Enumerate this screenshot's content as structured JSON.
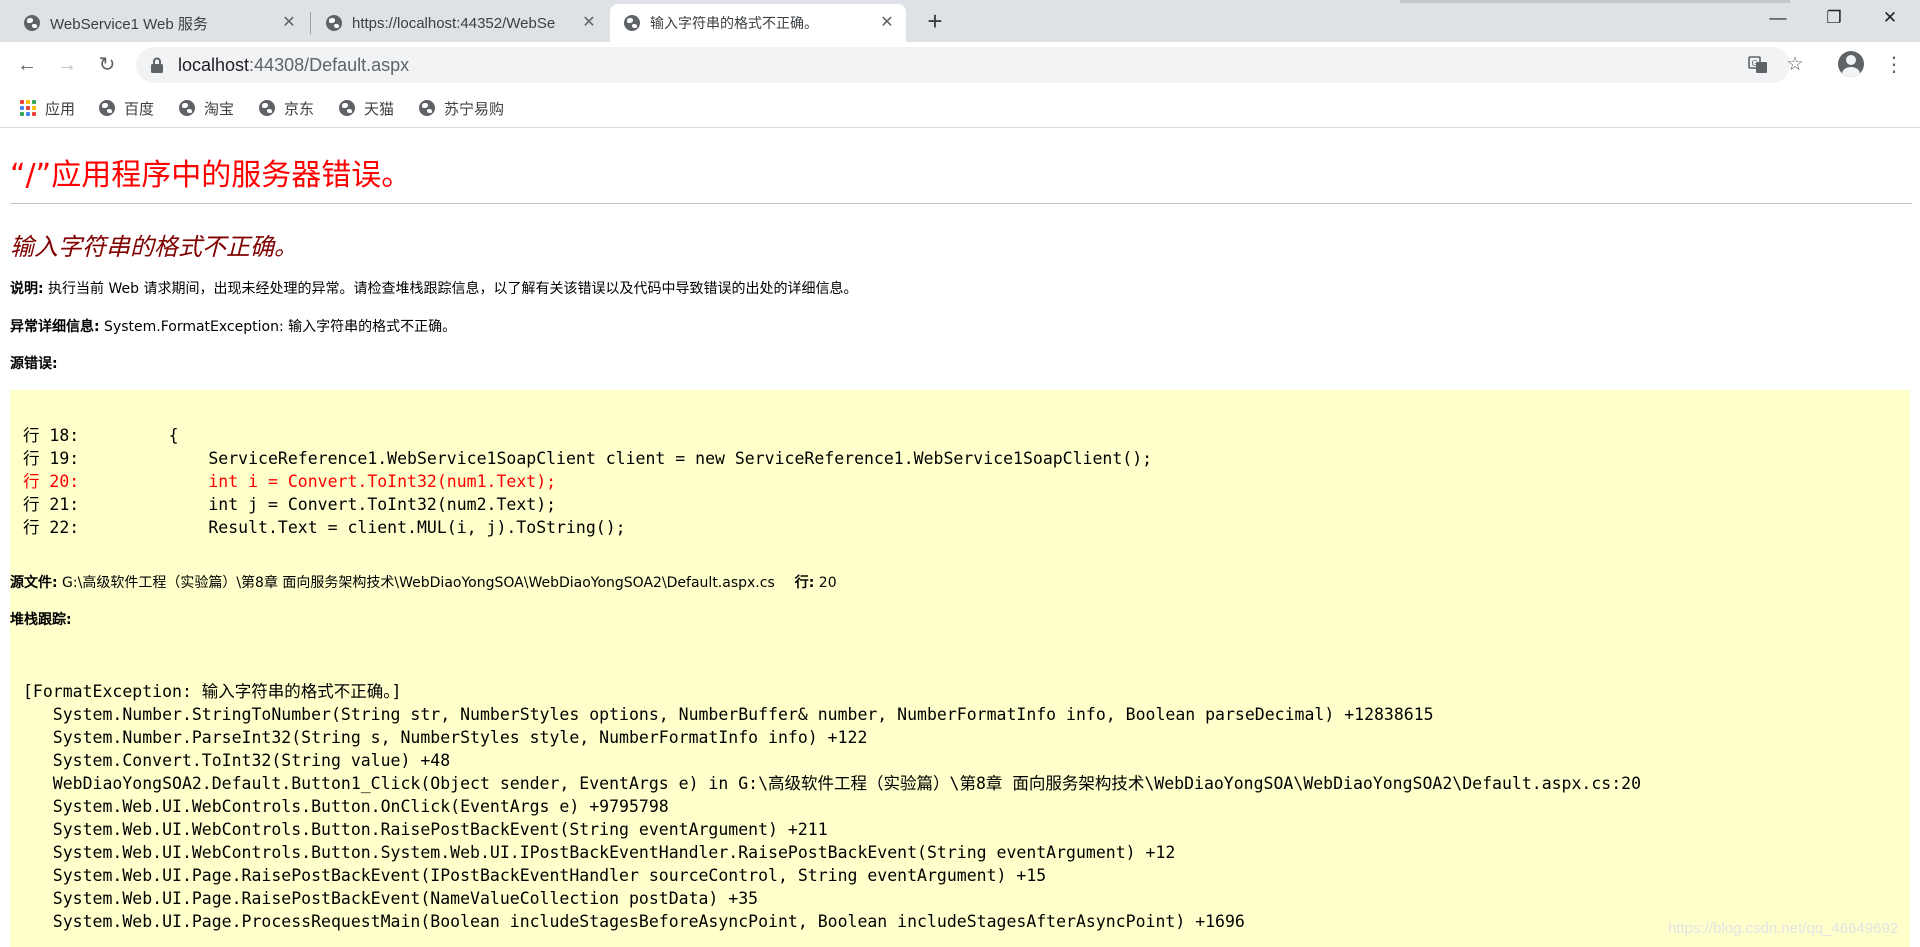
{
  "browser": {
    "tabs": [
      {
        "title": "WebService1 Web 服务",
        "active": false
      },
      {
        "title": "https://localhost:44352/WebSe",
        "active": false
      },
      {
        "title": "输入字符串的格式不正确。",
        "active": true
      }
    ],
    "new_tab_label": "+",
    "window_controls": {
      "minimize": "—",
      "maximize": "❐",
      "close": "✕"
    },
    "nav": {
      "back": "←",
      "forward": "→",
      "reload": "↻"
    },
    "address": {
      "host": "localhost",
      "path": ":44308/Default.aspx"
    },
    "omnibox_icons": {
      "translate": "translate-icon",
      "bookmark_star": "☆"
    },
    "menu": "⋮",
    "bookmarks": [
      {
        "label": "应用",
        "icon": "apps-grid-icon"
      },
      {
        "label": "百度",
        "icon": "globe-icon"
      },
      {
        "label": "淘宝",
        "icon": "globe-icon"
      },
      {
        "label": "京东",
        "icon": "globe-icon"
      },
      {
        "label": "天猫",
        "icon": "globe-icon"
      },
      {
        "label": "苏宁易购",
        "icon": "globe-icon"
      }
    ]
  },
  "page": {
    "title": "“/”应用程序中的服务器错误。",
    "subtitle": "输入字符串的格式不正确。",
    "description_label": "说明:",
    "description_text": " 执行当前 Web 请求期间，出现未经处理的异常。请检查堆栈跟踪信息，以了解有关该错误以及代码中导致错误的出处的详细信息。",
    "exception_label": "异常详细信息:",
    "exception_text": " System.FormatException: 输入字符串的格式不正确。",
    "source_error_label": "源错误:",
    "source_lines": [
      "行 18:         {",
      "行 19:             ServiceReference1.WebService1SoapClient client = new ServiceReference1.WebService1SoapClient();",
      "行 20:             int i = Convert.ToInt32(num1.Text);",
      "行 21:             int j = Convert.ToInt32(num2.Text);",
      "行 22:             Result.Text = client.MUL(i, j).ToString();"
    ],
    "highlighted_line_index": 2,
    "source_file_label": "源文件:",
    "source_file_path": " G:\\高级软件工程（实验篇）\\第8章 面向服务架构技术\\WebDiaoYongSOA\\WebDiaoYongSOA2\\Default.aspx.cs",
    "line_label": "行:",
    "line_number": " 20",
    "stack_trace_label": "堆栈跟踪:",
    "stack_lines": [
      "[FormatException: 输入字符串的格式不正确。]",
      "   System.Number.StringToNumber(String str, NumberStyles options, NumberBuffer& number, NumberFormatInfo info, Boolean parseDecimal) +12838615",
      "   System.Number.ParseInt32(String s, NumberStyles style, NumberFormatInfo info) +122",
      "   System.Convert.ToInt32(String value) +48",
      "   WebDiaoYongSOA2.Default.Button1_Click(Object sender, EventArgs e) in G:\\高级软件工程（实验篇）\\第8章 面向服务架构技术\\WebDiaoYongSOA\\WebDiaoYongSOA2\\Default.aspx.cs:20",
      "   System.Web.UI.WebControls.Button.OnClick(EventArgs e) +9795798",
      "   System.Web.UI.WebControls.Button.RaisePostBackEvent(String eventArgument) +211",
      "   System.Web.UI.WebControls.Button.System.Web.UI.IPostBackEventHandler.RaisePostBackEvent(String eventArgument) +12",
      "   System.Web.UI.Page.RaisePostBackEvent(IPostBackEventHandler sourceControl, String eventArgument) +15",
      "   System.Web.UI.Page.RaisePostBackEvent(NameValueCollection postData) +35",
      "   System.Web.UI.Page.ProcessRequestMain(Boolean includeStagesBeforeAsyncPoint, Boolean includeStagesAfterAsyncPoint) +1696"
    ],
    "watermark": "https://blog.csdn.net/qq_46649692"
  },
  "colors": {
    "error_title": "#ff0000",
    "error_subtitle": "#800000",
    "code_background": "#ffffcc",
    "highlight_line": "#ff0000",
    "tabstrip": "#dee1e6",
    "apps_grid": [
      "#ea4335",
      "#fbbc04",
      "#34a853",
      "#4285f4",
      "#ea4335",
      "#fbbc04",
      "#34a853",
      "#4285f4",
      "#ea4335"
    ]
  }
}
